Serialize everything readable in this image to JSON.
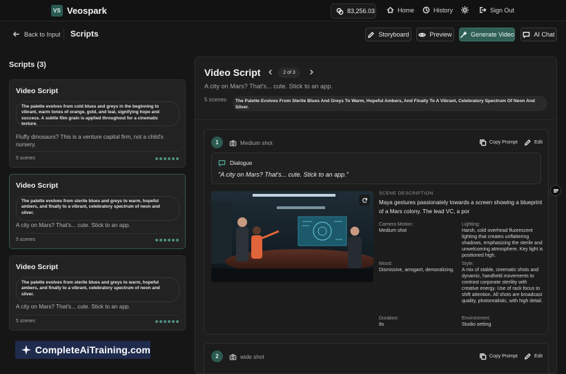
{
  "app": {
    "logo_badge": "VS",
    "brand": "Veospark",
    "credits": "83,256.03",
    "nav": [
      {
        "label": "Home",
        "icon": "home-icon"
      },
      {
        "label": "History",
        "icon": "history-icon"
      },
      {
        "label": "Sign Out",
        "icon": "sign-out-icon"
      }
    ]
  },
  "subbar": {
    "back_label": "Back to Input",
    "title": "Scripts",
    "buttons": {
      "storyboard": "Storyboard",
      "preview": "Preview",
      "generate": "Generate Video",
      "ai_chat": "AI Chat"
    }
  },
  "scripts_panel": {
    "title": "Scripts (3)",
    "cards": [
      {
        "title": "Video Script",
        "palette": "The palette evolves from cold blues and greys in the beginning to vibrant, warm tones of orange, gold, and teal, signifying hope and success. A subtle film grain is applied throughout for a cinematic texture.",
        "description": "Fluffy dinosaurs? This is a venture capital firm, not a child's nursery.",
        "scenes": "5 scenes"
      },
      {
        "title": "Video Script",
        "palette": "The palette evolves from sterile blues and greys to warm, hopeful ambers, and finally to a vibrant, celebratory spectrum of neon and silver.",
        "description": "A city on Mars? That's... cute. Stick to an app.",
        "scenes": "5 scenes"
      },
      {
        "title": "Video Script",
        "palette": "The palette evolves from sterile blues and greys to warm, hopeful ambers, and finally to a vibrant, celebratory spectrum of neon and silver.",
        "description": "A city on Mars? That's... cute. Stick to an app.",
        "scenes": "5 scenes"
      }
    ]
  },
  "watermark": "CompleteAiTraining.com",
  "main": {
    "title": "Video Script",
    "pager": "2 of 3",
    "subtitle": "A city on Mars? That's... cute. Stick to an app.",
    "scenes_count": "5 scenes",
    "palette": "The Palette Evolves From Sterile Blues And Greys To Warm, Hopeful Ambers, And Finally To A Vibrant, Celebratory Spectrum Of Neon And Silver.",
    "scenes": [
      {
        "number": "1",
        "shot": "Medium shot",
        "copy_label": "Copy Prompt",
        "edit_label": "Edit",
        "dialogue_label": "Dialogue",
        "dialogue": "\"A city on Mars? That's... cute. Stick to an app.\"",
        "scene_description_label": "SCENE DESCRIPTION",
        "scene_description": "Maya gestures passionately towards a screen showing a blueprint of a Mars colony. The lead VC, a por",
        "camera_motion_label": "Camera Motion:",
        "camera_motion": "Medium shot",
        "lighting_label": "Lighting:",
        "lighting": "Harsh, cold overhead fluorescent lighting that creates unflattering shadows, emphasizing the sterile and unwelcoming atmosphere. Key light is positioned high.",
        "mood_label": "Mood:",
        "mood": "Dismissive, arrogant, demoralizing.",
        "style_label": "Style:",
        "style": "A mix of stable, cinematic shots and dynamic, handheld movements to contrast corporate sterility with creative energy. Use of rack focus to shift attention. All shots are broadcast quality, photorealistic, with high detail.",
        "duration_label": "Duration:",
        "duration": "8s",
        "environment_label": "Environment:",
        "environment": "Studio setting"
      },
      {
        "number": "2",
        "shot": "wide shot",
        "copy_label": "Copy Prompt",
        "edit_label": "Edit"
      }
    ]
  },
  "colors": {
    "accent": "#2f5f55",
    "background": "#161616",
    "card": "#222222"
  }
}
